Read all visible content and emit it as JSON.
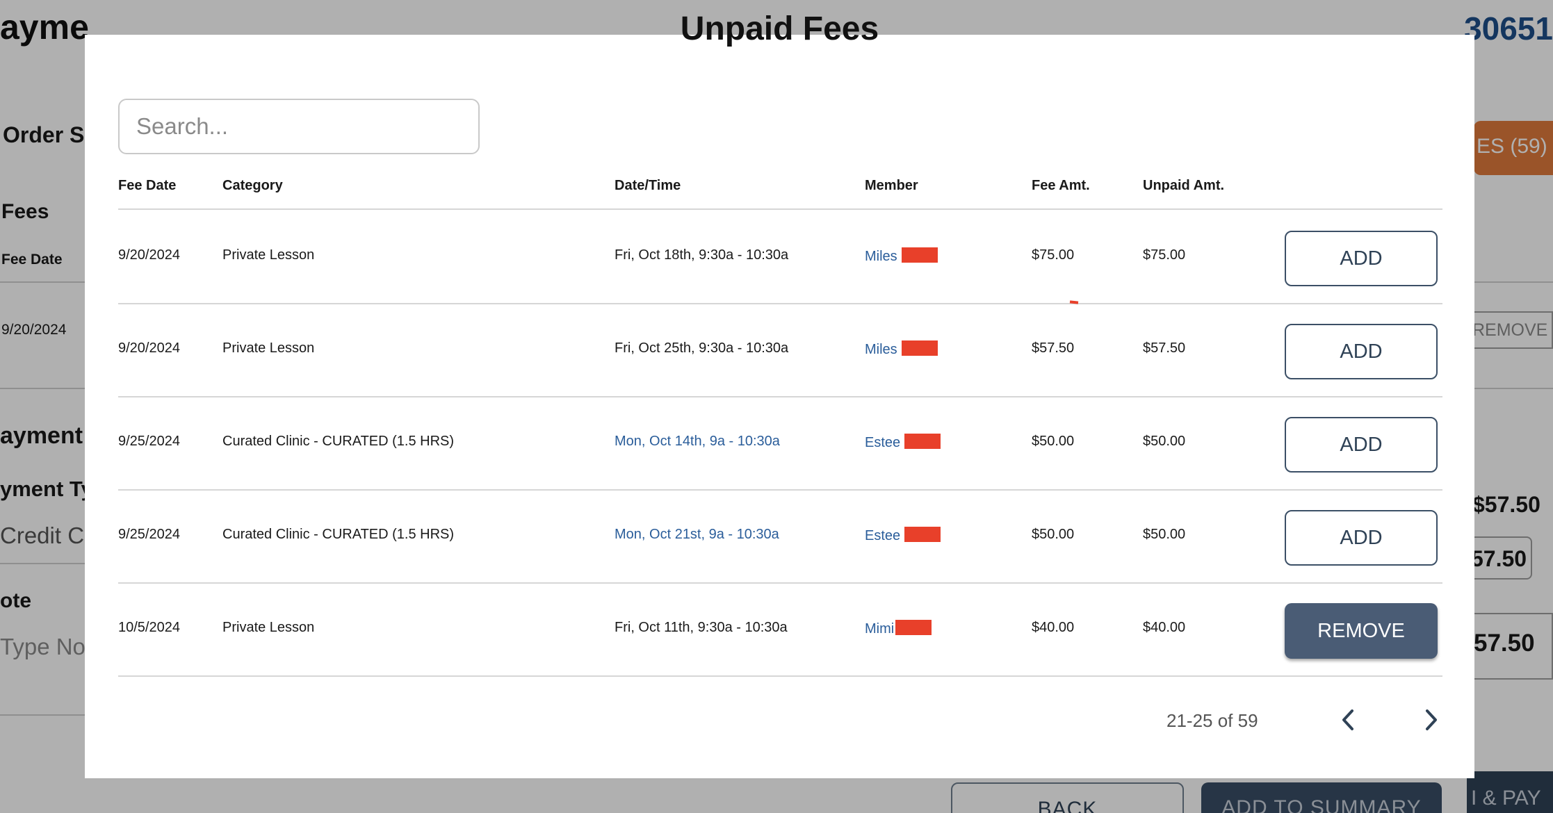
{
  "background": {
    "title_fragment": "ayme",
    "order_number_fragment": "30651",
    "order_summary_fragment": "Order S",
    "fees_label": "Fees",
    "fee_date_header": "Fee Date",
    "fee_date_value": "9/20/2024",
    "fees_button_fragment": "ES (59)",
    "remove_fragment": "REMOVE",
    "payment_label_fragment": "ayment I",
    "payment_type_fragment": "yment Ty",
    "credit_fragment": "Credit Ca",
    "note_fragment": "ote",
    "type_note_fragment": "Type No",
    "amount_1": "$57.50",
    "amount_2": "57.50",
    "amount_3": "57.50",
    "back_button": "BACK",
    "add_to_summary_button": "ADD TO SUMMARY",
    "submit_fragment": "I & PAY"
  },
  "modal": {
    "title": "Unpaid Fees",
    "search": {
      "placeholder": "Search..."
    },
    "columns": {
      "fee_date": "Fee Date",
      "category": "Category",
      "date_time": "Date/Time",
      "member": "Member",
      "fee_amt": "Fee Amt.",
      "unpaid_amt": "Unpaid Amt."
    },
    "rows": [
      {
        "fee_date": "9/20/2024",
        "category": "Private Lesson",
        "date_time": "Fri, Oct 18th, 9:30a - 10:30a",
        "member": "Miles",
        "fee_amt": "$75.00",
        "unpaid_amt": "$75.00",
        "action": "ADD"
      },
      {
        "fee_date": "9/20/2024",
        "category": "Private Lesson",
        "date_time": "Fri, Oct 25th, 9:30a - 10:30a",
        "member": "Miles",
        "fee_amt": "$57.50",
        "unpaid_amt": "$57.50",
        "action": "ADD"
      },
      {
        "fee_date": "9/25/2024",
        "category": "Curated Clinic - CURATED (1.5 HRS)",
        "date_time": "Mon, Oct 14th, 9a - 10:30a",
        "member": "Estee",
        "fee_amt": "$50.00",
        "unpaid_amt": "$50.00",
        "action": "ADD"
      },
      {
        "fee_date": "9/25/2024",
        "category": "Curated Clinic - CURATED (1.5 HRS)",
        "date_time": "Mon, Oct 21st, 9a - 10:30a",
        "member": "Estee",
        "fee_amt": "$50.00",
        "unpaid_amt": "$50.00",
        "action": "ADD"
      },
      {
        "fee_date": "10/5/2024",
        "category": "Private Lesson",
        "date_time": "Fri, Oct 11th, 9:30a - 10:30a",
        "member": "Mimi",
        "fee_amt": "$40.00",
        "unpaid_amt": "$40.00",
        "action": "REMOVE"
      }
    ],
    "pagination": {
      "range_text": "21-25 of 59"
    }
  },
  "colors": {
    "accent_orange": "#e07a3c",
    "primary_dark": "#4a5c75",
    "link_blue": "#2a5d9a",
    "redaction_red": "#e8402a"
  },
  "icons": {
    "prev": "chevron-left-icon",
    "next": "chevron-right-icon"
  }
}
